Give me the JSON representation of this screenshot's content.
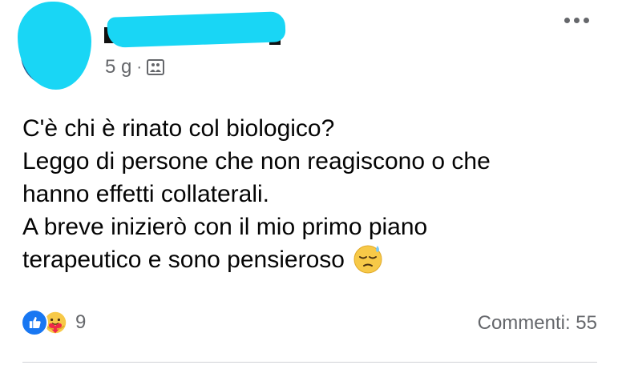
{
  "post": {
    "time": "5 g",
    "separator": "·",
    "privacy_icon": "photo-icon",
    "text_lines": [
      "C'è chi è rinato col biologico?",
      "Leggo di persone che non reagiscono o che",
      "hanno effetti collaterali.",
      "A breve inizierò con il mio primo piano",
      "terapeutico e sono pensieroso"
    ],
    "emoji": "pensive-sweat-emoji"
  },
  "reactions": {
    "icons": [
      "like-icon",
      "care-icon"
    ],
    "count": "9"
  },
  "comments": {
    "label": "Commenti: 55"
  },
  "colors": {
    "redaction": "#19d6f5",
    "like_blue": "#1877f2",
    "secondary_text": "#65676b"
  }
}
